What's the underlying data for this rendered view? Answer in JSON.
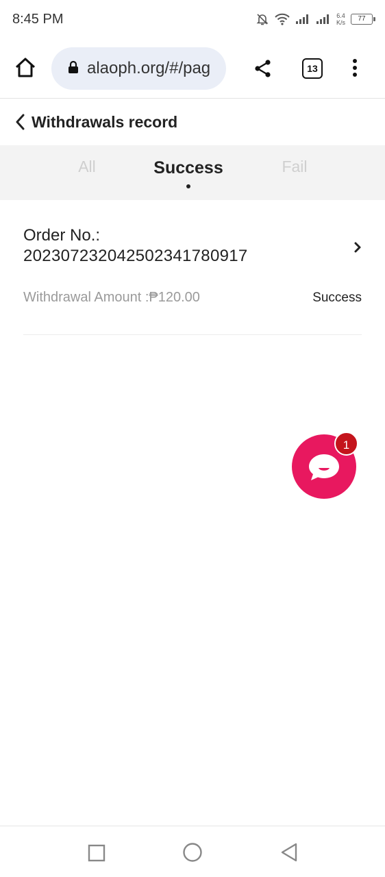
{
  "status_bar": {
    "time": "8:45 PM",
    "net_speed_value": "6.4",
    "net_speed_unit": "K/s",
    "battery": "77"
  },
  "browser": {
    "url": "alaoph.org/#/pag",
    "tab_count": "13"
  },
  "header": {
    "title": "Withdrawals record"
  },
  "tabs": [
    {
      "label": "All",
      "active": false
    },
    {
      "label": "Success",
      "active": true
    },
    {
      "label": "Fail",
      "active": false
    }
  ],
  "records": [
    {
      "order_label": "Order No.:",
      "order_number": "20230723204250234178091​7",
      "amount_label": "Withdrawal Amount :₱120.00",
      "status": "Success"
    }
  ],
  "chat": {
    "badge_count": "1",
    "accent": "#e8185f"
  }
}
